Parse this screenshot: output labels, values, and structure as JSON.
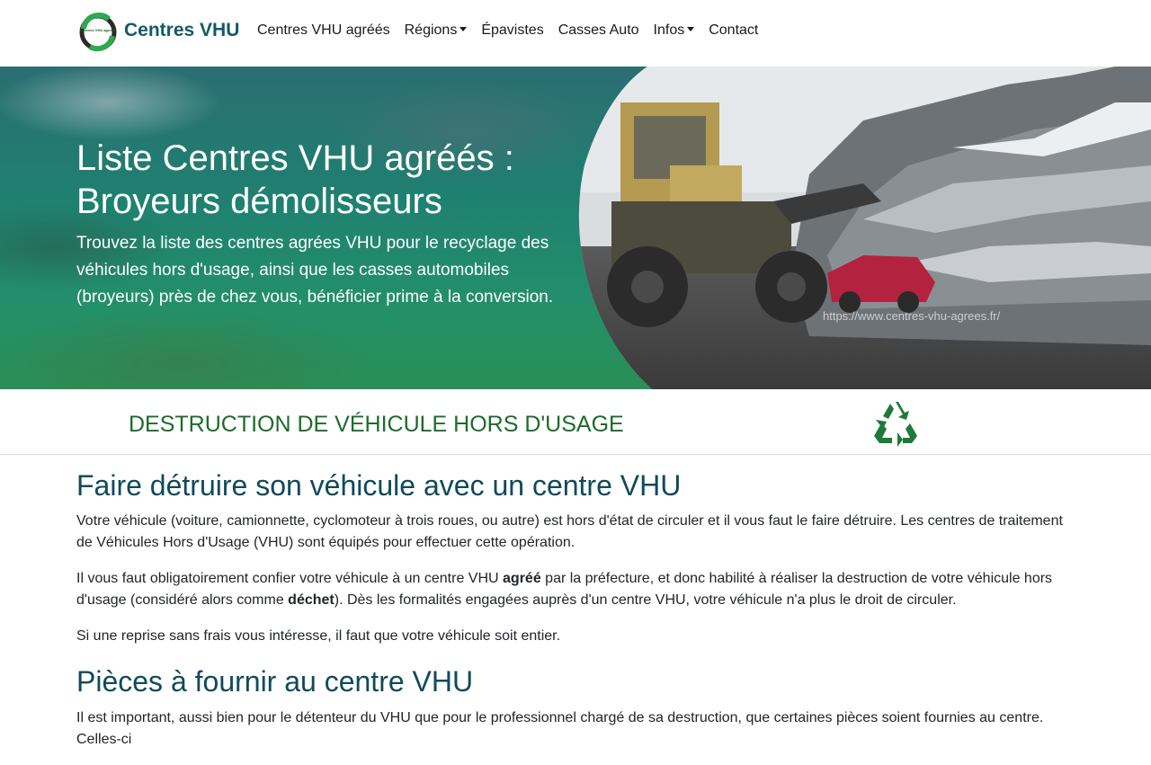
{
  "brand": {
    "name": "Centres VHU",
    "logo_text": "Centres VHU agréés"
  },
  "nav": {
    "items": [
      {
        "label": "Centres VHU agréés",
        "dropdown": false
      },
      {
        "label": "Régions",
        "dropdown": true
      },
      {
        "label": "Épavistes",
        "dropdown": false
      },
      {
        "label": "Casses Auto",
        "dropdown": false
      },
      {
        "label": "Infos",
        "dropdown": true
      },
      {
        "label": "Contact",
        "dropdown": false
      }
    ]
  },
  "hero": {
    "title_line1": "Liste Centres VHU agréés :",
    "title_line2": "Broyeurs démolisseurs",
    "subtitle": "Trouvez la liste des centres agrées VHU pour le recyclage des véhicules hors d'usage, ainsi que les casses automobiles (broyeurs) près de chez vous, bénéficier prime à la conversion.",
    "watermark": "https://www.centres-vhu-agrees.fr/"
  },
  "banner": {
    "title": "DESTRUCTION DE VÉHICULE HORS D'USAGE",
    "icon": "recycle-icon"
  },
  "section1": {
    "heading": "Faire détruire son véhicule avec un centre VHU",
    "p1": "Votre véhicule (voiture, camionnette, cyclomoteur à trois roues, ou autre) est hors d'état de circuler et il vous faut le faire détruire. Les centres de traitement de Véhicules Hors d'Usage (VHU) sont équipés pour effectuer cette opération.",
    "p2_a": "Il vous faut obligatoirement confier votre véhicule à un centre VHU ",
    "p2_b": "agréé",
    "p2_c": " par la préfecture, et donc habilité à réaliser la destruction de votre véhicule hors d'usage (considéré alors comme ",
    "p2_d": "déchet",
    "p2_e": "). Dès les formalités engagées auprès d'un centre VHU, votre véhicule n'a plus le droit de circuler.",
    "p3": "Si une reprise sans frais vous intéresse, il faut que votre véhicule soit entier."
  },
  "section2": {
    "heading": "Pièces à fournir au centre VHU",
    "p1": "Il est important, aussi bien pour le détenteur du VHU que pour le professionnel chargé de sa destruction, que certaines pièces soient fournies au centre. Celles-ci"
  },
  "colors": {
    "brand": "#135a6a",
    "heading": "#0f4a5c",
    "banner": "#1e6b2a",
    "recycle": "#1f7a3a"
  }
}
